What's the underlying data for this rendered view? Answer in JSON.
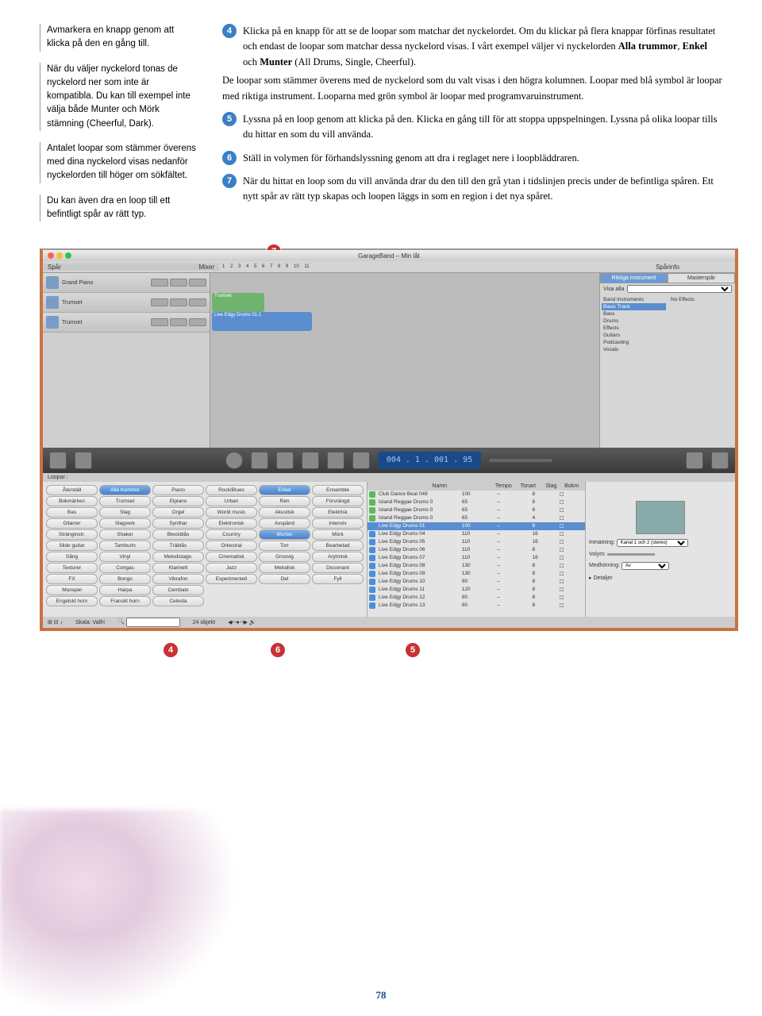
{
  "sidebar": {
    "p1": "Avmarkera en knapp genom att klicka på den en gång till.",
    "p2": "När du väljer nyckelord tonas de nyckelord ner som inte är kompatibla. Du kan till exempel inte välja både Munter och Mörk stämning (Cheerful, Dark).",
    "p3": "Antalet loopar som stämmer överens med dina nyckelord visas nedanför nyckelorden till höger om sökfältet.",
    "p4": "Du kan även dra en loop till ett befintligt spår av rätt typ."
  },
  "steps": {
    "s4a": "Klicka på en knapp för att se de loopar som matchar det nyckelordet. Om du klickar på flera knappar förfinas resultatet och endast de loopar som matchar dessa nyckelord visas. I vårt exempel väljer vi nyckelorden ",
    "s4b": "Alla trummor",
    "s4c": ", ",
    "s4d": "Enkel",
    "s4e": " och ",
    "s4f": "Munter",
    "s4g": " (All Drums, Single, Cheerful).",
    "s4p": "De loopar som stämmer överens med de nyckelord som du valt visas i den högra kolumnen. Loopar med blå symbol är loopar med riktiga instrument. Looparna med grön symbol är loopar med programvaruinstrument.",
    "s5": "Lyssna på en loop genom att klicka på den. Klicka en gång till för att stoppa uppspelningen. Lyssna på olika loopar tills du hittar en som du vill använda.",
    "s6": "Ställ in volymen för förhandslyssning genom att dra i reglaget nere i loop­bläddraren.",
    "s7": "När du hittat en loop som du vill använda drar du den till den grå ytan i tidslinjen precis under de befintliga spåren. Ett nytt spår av rätt typ skapas och loopen läggs in som en region i det nya spåret."
  },
  "win": {
    "title": "GarageBand – Min låt",
    "trackhead_spar": "Spår",
    "trackhead_mixer": "Mixer",
    "trackhead_info": "Spårinfo",
    "tracks": [
      "Grand Piano",
      "Trumset",
      "Trumset"
    ],
    "region1": "Trumset",
    "region2": "Live Edgy Drums 01.1",
    "sp_tab1": "Riktiga instrument",
    "sp_tab2": "Masterspår",
    "sp_visa": "Visa alla",
    "sp_left": [
      "Band Instruments",
      "Basic Track",
      "Bass",
      "Drums",
      "Effects",
      "Guitars",
      "Podcasting",
      "Vocals"
    ],
    "sp_right": "No Effects",
    "lcd": "004 . 1 . 001 . 95",
    "loopar": "Loopar :",
    "kw_rows": [
      [
        "Återställ",
        "Alla trummor",
        "Piano",
        "Rock/Blues",
        "Enkel",
        "Ensemble"
      ],
      [
        "Bokmärken",
        "Trumset",
        "Elpiano",
        "Urban",
        "Ren",
        "Förvrängd"
      ],
      [
        "Bas",
        "Slag",
        "Orgel",
        "World music",
        "Akustisk",
        "Elektrisk"
      ],
      [
        "Gitarrer",
        "Slagverk",
        "Synthar",
        "Elektronisk",
        "Avspänd",
        "Intensiv"
      ],
      [
        "Stränginstr.",
        "Shaker",
        "Bleckblås",
        "Country",
        "Munter",
        "Mörk"
      ],
      [
        "Slide guitar",
        "Tamburin",
        "Träblås",
        "Orkestral",
        "Torr",
        "Bearbetad"
      ],
      [
        "Sång",
        "Vinyl",
        "Melodislagv.",
        "Cinematisk",
        "Groovig",
        "Arytmisk"
      ],
      [
        "Texturer",
        "Congas",
        "Klarinett",
        "Jazz",
        "Melodisk",
        "Dissonant"
      ],
      [
        "FX",
        "Bongo",
        "Vibrafon",
        "Experimentell",
        "Del",
        "Fyll"
      ],
      [
        "Munspel",
        "Harpa",
        "Cembalo",
        "",
        "",
        ""
      ],
      [
        "Engelskt horn",
        "Franskt horn",
        "Celesta",
        "",
        "",
        ""
      ]
    ],
    "kw_selected": [
      "Alla trummor",
      "Enkel",
      "Munter"
    ],
    "res_cols": [
      "Namn",
      "Tempo",
      "Tonart",
      "Slag",
      "Bokm"
    ],
    "results": [
      {
        "c": "green2",
        "n": "Club Dance Beat 049",
        "t": "100",
        "k": "–",
        "b": "8"
      },
      {
        "c": "green2",
        "n": "Island Reggae Drums 0",
        "t": "65",
        "k": "–",
        "b": "8"
      },
      {
        "c": "green2",
        "n": "Island Reggae Drums 0",
        "t": "65",
        "k": "–",
        "b": "8"
      },
      {
        "c": "green2",
        "n": "Island Reggae Drums 0",
        "t": "65",
        "k": "–",
        "b": "4"
      },
      {
        "c": "blue",
        "n": "Live Edgy Drums 01",
        "t": "100",
        "k": "–",
        "b": "8",
        "sel": true
      },
      {
        "c": "blue",
        "n": "Live Edgy Drums 04",
        "t": "110",
        "k": "–",
        "b": "16"
      },
      {
        "c": "blue",
        "n": "Live Edgy Drums 05",
        "t": "110",
        "k": "–",
        "b": "16"
      },
      {
        "c": "blue",
        "n": "Live Edgy Drums 06",
        "t": "110",
        "k": "–",
        "b": "8"
      },
      {
        "c": "blue",
        "n": "Live Edgy Drums 07",
        "t": "110",
        "k": "–",
        "b": "16"
      },
      {
        "c": "blue",
        "n": "Live Edgy Drums 08",
        "t": "130",
        "k": "–",
        "b": "8"
      },
      {
        "c": "blue",
        "n": "Live Edgy Drums 09",
        "t": "130",
        "k": "–",
        "b": "8"
      },
      {
        "c": "blue",
        "n": "Live Edgy Drums 10",
        "t": "80",
        "k": "–",
        "b": "8"
      },
      {
        "c": "blue",
        "n": "Live Edgy Drums 11",
        "t": "120",
        "k": "–",
        "b": "8"
      },
      {
        "c": "blue",
        "n": "Live Edgy Drums 12",
        "t": "80",
        "k": "–",
        "b": "8"
      },
      {
        "c": "blue",
        "n": "Live Edgy Drums 13",
        "t": "80",
        "k": "–",
        "b": "8"
      }
    ],
    "inmatning_l": "Inmatning:",
    "inmatning_v": "Kanal 1 och 2 (stereo)",
    "volym_l": "Volym:",
    "medhorning_l": "Medhörning:",
    "medhorning_v": "Av",
    "detaljer": "Detaljer",
    "skala_l": "Skala:",
    "skala_v": "Valfri",
    "objekt": "24 objekt"
  },
  "callouts": {
    "c4": "4",
    "c5": "5",
    "c6": "6",
    "c7": "7"
  },
  "pagenum": "78"
}
